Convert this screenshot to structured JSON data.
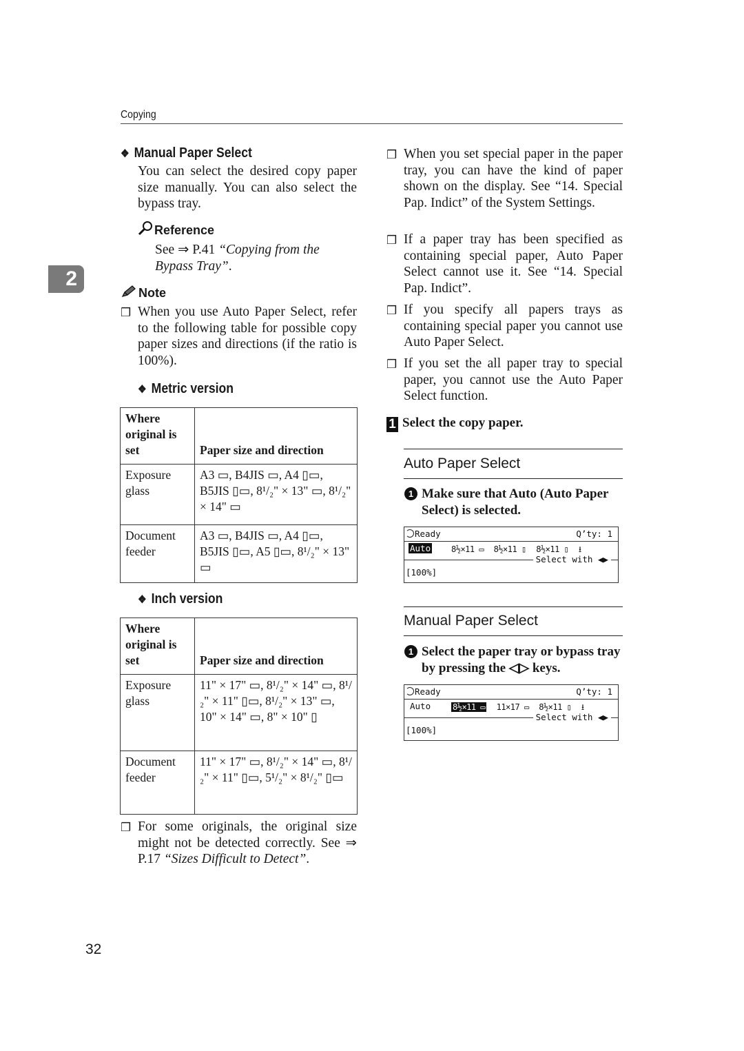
{
  "header": {
    "running_head": "Copying"
  },
  "chapter_tab": "2",
  "page_number": "32",
  "left": {
    "manual_heading": "Manual Paper Select",
    "manual_body": "You can select the desired copy paper size manually. You can also select the bypass tray.",
    "reference": {
      "title": "Reference",
      "prefix": "See ⇒ P.41 ",
      "link": "“Copying from the Bypass Tray”",
      "suffix": "."
    },
    "note": {
      "title": "Note",
      "item1": "When you use Auto Paper Select, refer to the following table for possible copy paper sizes and directions (if the ratio is 100%)."
    },
    "metric_heading": "Metric version",
    "metric_table": {
      "header_col1": "Where original is set",
      "header_col2": "Paper size and direction",
      "rows": [
        {
          "where": "Exposure glass",
          "sizes": "A3 ▭, B4JIS ▭, A4 ▯▭, B5JIS ▯▭, 8¹/₂\" × 13\" ▭, 8¹/₂\" × 14\" ▭"
        },
        {
          "where": "Document feeder",
          "sizes": "A3 ▭, B4JIS ▭, A4 ▯▭, B5JIS ▯▭, A5 ▯▭, 8¹/₂\" × 13\" ▭"
        }
      ]
    },
    "inch_heading": "Inch version",
    "inch_table": {
      "header_col1": "Where original is set",
      "header_col2": "Paper size and direction",
      "rows": [
        {
          "where": "Exposure glass",
          "sizes": "11\" × 17\" ▭, 8¹/₂\" × 14\" ▭, 8¹/₂\" × 11\" ▯▭, 8¹/₂\" × 13\" ▭, 10\" × 14\" ▭, 8\" × 10\" ▯"
        },
        {
          "where": "Document feeder",
          "sizes": "11\" × 17\" ▭, 8¹/₂\" × 14\" ▭, 8¹/₂\" × 11\" ▯▭, 5¹/₂\" × 8¹/₂\" ▯▭"
        }
      ]
    },
    "note2": {
      "prefix": "For some originals, the original size might not be detected correctly. See ⇒ P.17 ",
      "link": "“Sizes Difficult to Detect”",
      "suffix": "."
    }
  },
  "right": {
    "notes": [
      "When you set special paper in the paper tray, you can have the kind of paper shown on the display. See “14. Special Pap. Indict” of the System Settings.",
      "If a paper tray has been specified as containing special paper, Auto Paper Select cannot use it. See “14. Special Pap. Indict”.",
      "If you specify all papers trays as containing special paper you cannot use Auto Paper Select.",
      "If you set the all paper tray to special paper, you cannot use the Auto Paper Select function."
    ],
    "step1": {
      "number": "1",
      "text": "Select the copy paper."
    },
    "auto_section": {
      "title": "Auto Paper Select",
      "substep_num": "1",
      "substep": "Make sure that Auto (Auto Paper Select) is selected.",
      "lcd": {
        "status": "Ready",
        "qty": "Q’ty: 1",
        "auto": "Auto",
        "trays": [
          "8½×11 ▭",
          "8½×11 ▯",
          "8½×11 ▯",
          "⭳"
        ],
        "selected_tray": "Auto",
        "select_with": "Select with ◀▶",
        "ratio": "[100%]"
      }
    },
    "manual_section": {
      "title": "Manual Paper Select",
      "substep_num": "1",
      "substep": "Select the paper tray or bypass tray by pressing the ◁▷ keys.",
      "lcd": {
        "status": "Ready",
        "qty": "Q’ty: 1",
        "auto": "Auto",
        "trays": [
          "8½×11 ▭",
          "11×17 ▭",
          "8½×11 ▯",
          "⭳"
        ],
        "selected_tray": "8½×11 ▭",
        "select_with": "Select with ◀▶",
        "ratio": "[100%]"
      }
    }
  }
}
